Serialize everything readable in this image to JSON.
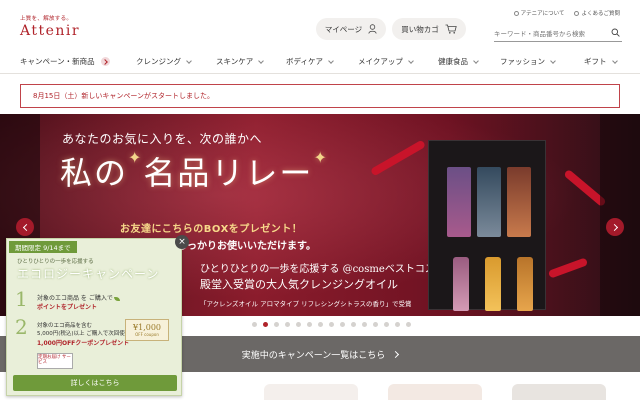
{
  "brand": {
    "tagline": "上質を、解放する。",
    "name": "Attenir"
  },
  "top_links": {
    "about": "アテニアについて",
    "faq": "よくあるご質問"
  },
  "header": {
    "mypage": "マイページ",
    "cart": "買い物カゴ",
    "search_placeholder": "キーワード・商品番号から検索"
  },
  "nav": [
    {
      "label": "キャンペーン・新商品"
    },
    {
      "label": "クレンジング"
    },
    {
      "label": "スキンケア"
    },
    {
      "label": "ボディケア"
    },
    {
      "label": "メイクアップ"
    },
    {
      "label": "健康食品"
    },
    {
      "label": "ファッション"
    },
    {
      "label": "ギフト"
    }
  ],
  "notice": "8月15日（土）新しいキャンペーンがスタートしました。",
  "hero": {
    "subtitle": "あなたのお気に入りを、次の誰かへ",
    "title_a": "私の",
    "title_b": "名品リレー",
    "promo_line1": "お友達にこちらのBOXをプレゼント！",
    "promo_line2": "約1カ月分、しっかりお使いいただけます。",
    "award_line1": "ひとりひとりの一歩を応援する @cosmeベストコスメアワード",
    "award_line2": "殿堂入受賞の大人気クレンジングオイル",
    "award_line3": "「アクレンズオイル アロマタイプ リフレシングシトラスの香り」で受賞",
    "slide_count": 15,
    "active_slide": 2
  },
  "campaign_bar": "実施中のキャンペーン一覧はこちら",
  "popup": {
    "tag": "期間限定 9/14まで",
    "slogan": "ひとりひとりの一歩を応援する",
    "title": "エコロジーキャンペーン",
    "step1_num": "1",
    "step1_a": "対象のエコ商品 を ご購入で",
    "step1_b": "ポイントをプレゼント",
    "step2_num": "2",
    "step2_a": "対象のエコ商品を含む",
    "step2_b": "5,000円(税込)以上 ご購入で次回使える",
    "step2_c": "1,000円OFFクーポンプレゼント",
    "coupon_value": "¥1,000",
    "coupon_label": "OFF coupon",
    "stamp": "定期お届け サービス",
    "more": "詳しくはこちら"
  },
  "colors": {
    "brand_red": "#b0232a",
    "popup_green": "#6f9a3a",
    "campaign_bar": "#6b6866"
  }
}
